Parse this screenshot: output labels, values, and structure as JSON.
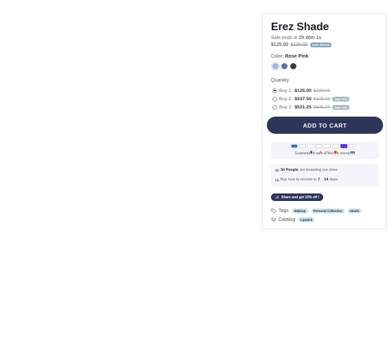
{
  "product": {
    "title": "Erez Shade",
    "sale": {
      "prefix": "Sale ends in",
      "countdown": "2h 46m 1s"
    },
    "price": {
      "current": "$125.00",
      "original": "$125.00",
      "badge": "Save $75.00"
    }
  },
  "color": {
    "label": "Color:",
    "selected": "Rose Pink",
    "swatches": [
      {
        "name": "rose-pink",
        "hex": "#9cbad8"
      },
      {
        "name": "blue",
        "hex": "#5d74b0"
      },
      {
        "name": "charcoal",
        "hex": "#3c3c3c"
      }
    ]
  },
  "quantity": {
    "label": "Quantity",
    "options": [
      {
        "label": "Buy 1:",
        "price": "$125.00",
        "old": "$200.00",
        "badge": "",
        "selected": true
      },
      {
        "label": "Buy 2:",
        "price": "$337.50",
        "old": "$375.00",
        "badge": "Save 10%",
        "selected": false
      },
      {
        "label": "Buy 2:",
        "price": "$531.25",
        "old": "$625.00",
        "badge": "Save 15%",
        "selected": false
      }
    ]
  },
  "add_to_cart": "ADD TO CART",
  "checkout": {
    "text": "Guaranteed safe & secure checkout",
    "payment_icons": [
      "amex-icon",
      "apple-pay-icon",
      "diners-icon",
      "discover-icon",
      "gpay-icon",
      "mastercard-icon",
      "shop-pay-icon",
      "visa-icon"
    ]
  },
  "activity": {
    "browsing_count": "34 People",
    "browsing_text": "are browsing our store",
    "delivery_prefix": "Buy now to receive in",
    "delivery_from": "7",
    "delivery_sep": "-",
    "delivery_to": "14",
    "delivery_suffix": "days"
  },
  "share": "Share and get 15% off !",
  "tags": {
    "label": "Tags",
    "items": [
      "Makeup",
      "Personal Collection",
      "Shade"
    ]
  },
  "catalog": {
    "label": "Catalog",
    "items": [
      "Lipstick"
    ]
  },
  "colors": {
    "accent": "#2f3557",
    "chip": "#c6e1ec",
    "badge": "#8aa3b6"
  }
}
